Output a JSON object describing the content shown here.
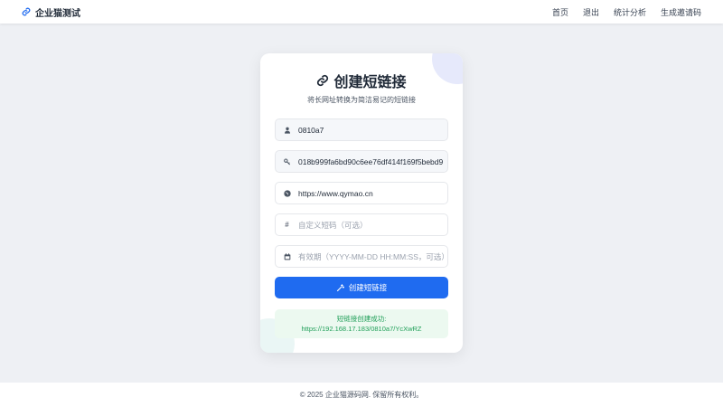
{
  "navbar": {
    "brand": "企业猫测试",
    "links": [
      "首页",
      "退出",
      "统计分析",
      "生成邀请码"
    ]
  },
  "card": {
    "title": "创建短链接",
    "subtitle": "将长网址转换为简洁易记的短链接",
    "fields": {
      "username": {
        "value": "0810a7",
        "icon": "user-icon"
      },
      "key": {
        "value": "018b999fa6bd90c6ee76df414f169f5bebd9",
        "icon": "key-icon"
      },
      "url": {
        "value": "https://www.qymao.cn",
        "icon": "globe-icon"
      },
      "custom_code": {
        "placeholder": "自定义短码（可选）",
        "icon": "hash-icon"
      },
      "expiry": {
        "placeholder": "有效期（YYYY-MM-DD HH:MM:SS，可选）",
        "icon": "calendar-icon"
      }
    },
    "submit_label": "创建短链接",
    "result": {
      "heading": "短链接创建成功:",
      "link": "https://192.168.17.183/0810a7/YcXwRZ"
    }
  },
  "footer": {
    "text": "© 2025 企业猫源码网. 保留所有权利。"
  },
  "colors": {
    "primary": "#1f6bf0",
    "success": "#22a05a",
    "success_bg": "#ecf9f0"
  }
}
